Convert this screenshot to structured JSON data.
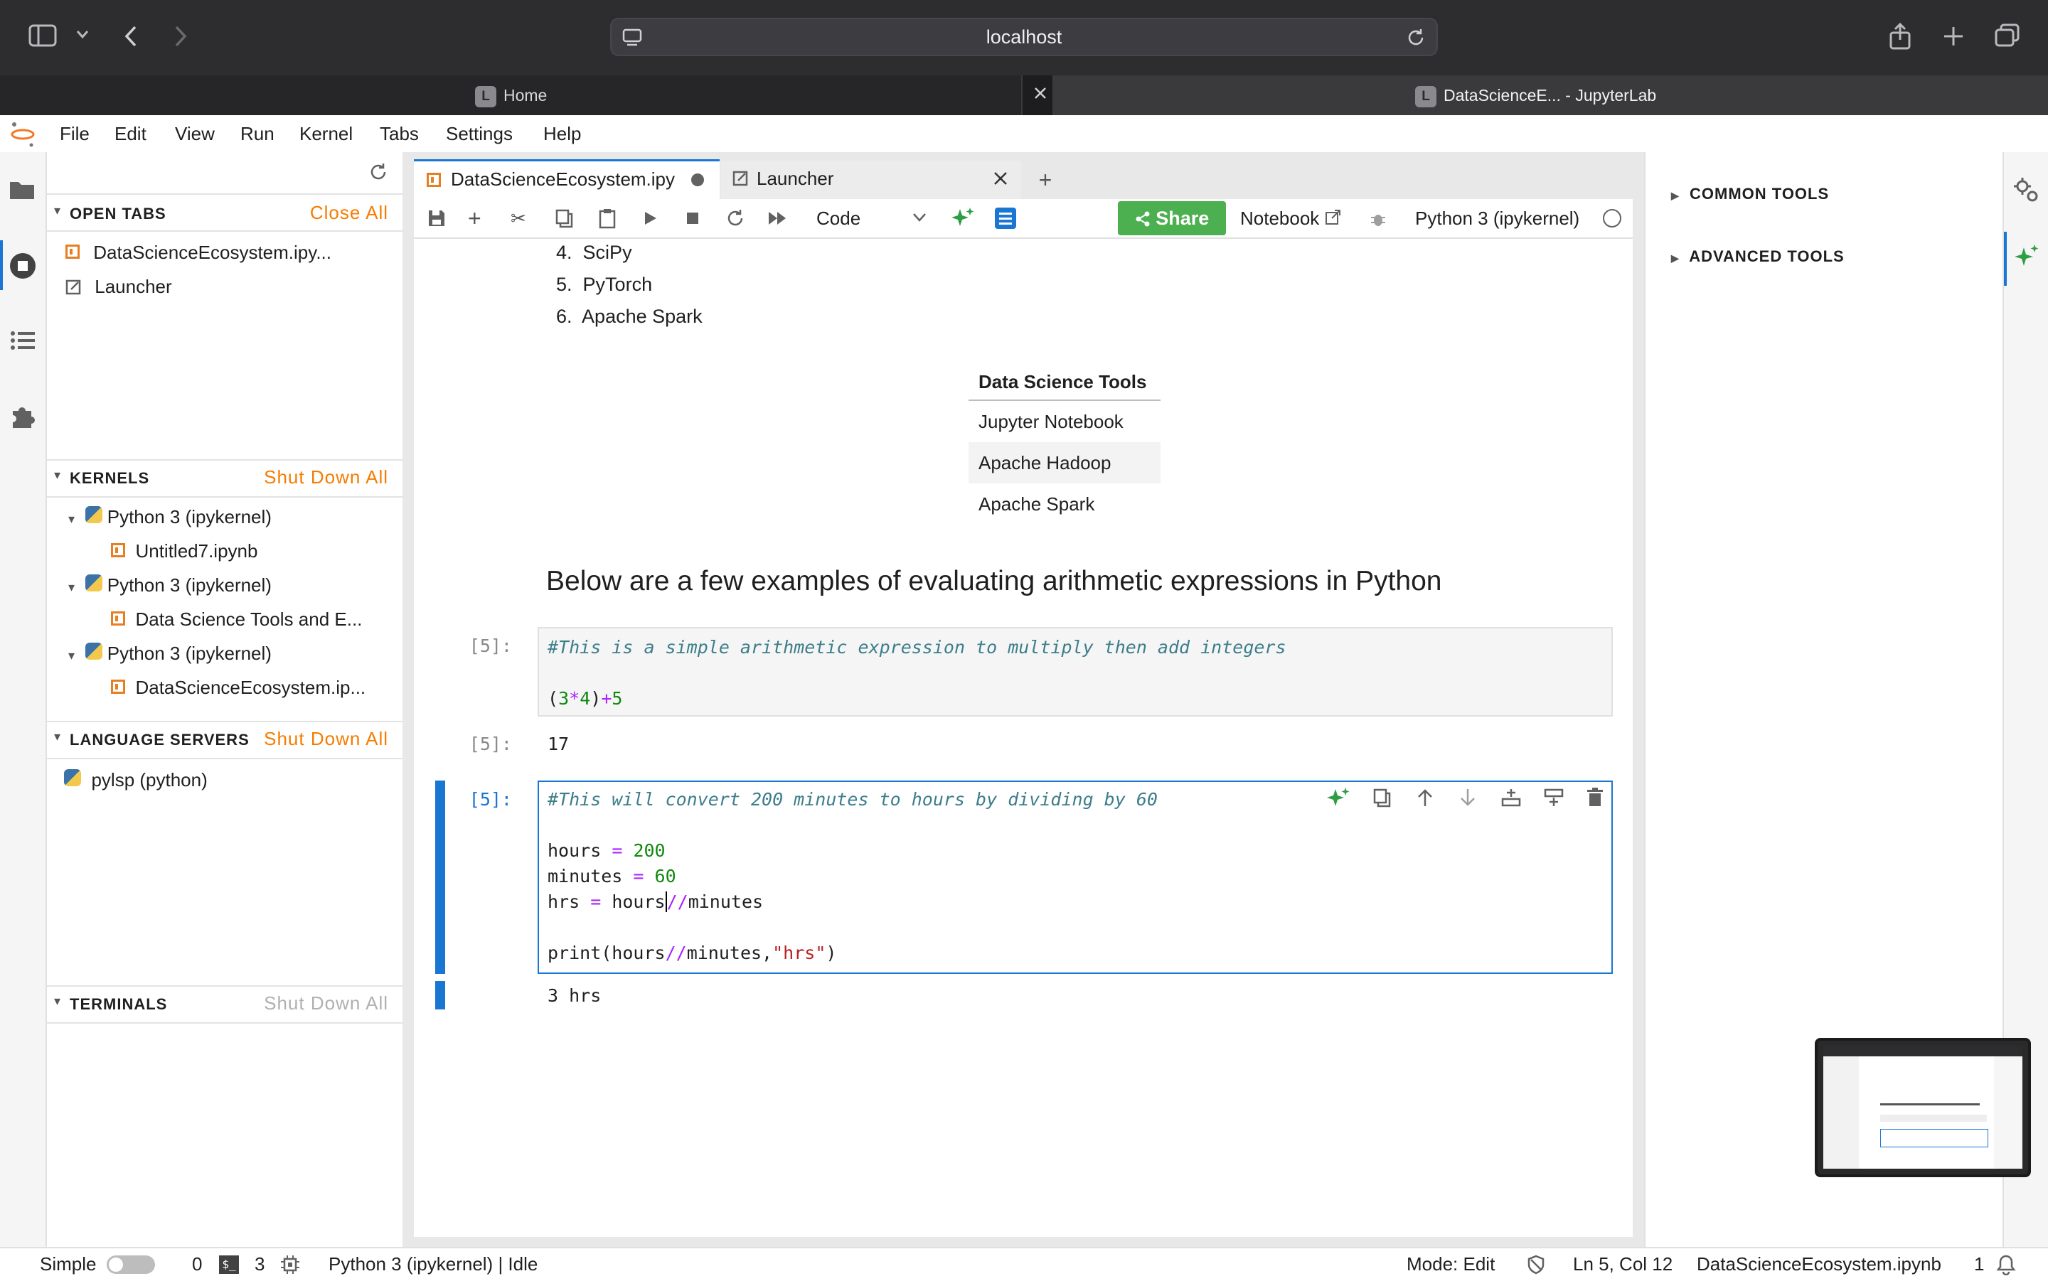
{
  "browser": {
    "url": "localhost",
    "tabs": [
      {
        "label": "Home",
        "favicon": "L"
      },
      {
        "label": "DataScienceE... - JupyterLab",
        "favicon": "L"
      }
    ]
  },
  "menubar": [
    "File",
    "Edit",
    "View",
    "Run",
    "Kernel",
    "Tabs",
    "Settings",
    "Help"
  ],
  "left_panel": {
    "open_tabs": {
      "title": "OPEN TABS",
      "action": "Close All",
      "items": [
        "DataScienceEcosystem.ipy...",
        "Launcher"
      ]
    },
    "kernels": {
      "title": "KERNELS",
      "action": "Shut Down All",
      "groups": [
        {
          "kernel": "Python 3 (ipykernel)",
          "file": "Untitled7.ipynb"
        },
        {
          "kernel": "Python 3 (ipykernel)",
          "file": "Data Science Tools and E..."
        },
        {
          "kernel": "Python 3 (ipykernel)",
          "file": "DataScienceEcosystem.ip..."
        }
      ]
    },
    "language_servers": {
      "title": "LANGUAGE SERVERS",
      "action": "Shut Down All",
      "items": [
        "pylsp (python)"
      ]
    },
    "terminals": {
      "title": "TERMINALS",
      "action": "Shut Down All"
    }
  },
  "doc_tabs": {
    "active": "DataScienceEcosystem.ipy",
    "other": "Launcher"
  },
  "toolbar": {
    "cell_type": "Code",
    "share": "Share",
    "notebook": "Notebook",
    "kernel_name": "Python 3 (ipykernel)"
  },
  "notebook": {
    "list_items": [
      {
        "n": "4.",
        "text": "SciPy"
      },
      {
        "n": "5.",
        "text": "PyTorch"
      },
      {
        "n": "6.",
        "text": "Apache Spark"
      }
    ],
    "table": {
      "header": "Data Science Tools",
      "rows": [
        "Jupyter Notebook",
        "Apache Hadoop",
        "Apache Spark"
      ]
    },
    "heading": "Below are a few examples of evaluating arithmetic expressions in Python",
    "cell1": {
      "prompt": "[5]:",
      "comment": "#This is a simple arithmetic expression to multiply then add integers",
      "output_prompt": "[5]:",
      "output": "17"
    },
    "cell2": {
      "prompt": "[5]:",
      "comment": "#This will convert 200 minutes to hours by dividing by 60",
      "output": "3 hrs"
    }
  },
  "right_panel": {
    "sections": [
      "COMMON TOOLS",
      "ADVANCED TOOLS"
    ]
  },
  "statusbar": {
    "mode_label": "Simple",
    "count_a": "0",
    "count_b": "3",
    "kernel_status": "Python 3 (ipykernel) | Idle",
    "mode": "Mode: Edit",
    "position": "Ln 5, Col 12",
    "filename": "DataScienceEcosystem.ipynb",
    "notifications": "1"
  },
  "colors": {
    "accent": "#1976d2",
    "orange": "#f57c00",
    "share_green": "#4caf50"
  }
}
